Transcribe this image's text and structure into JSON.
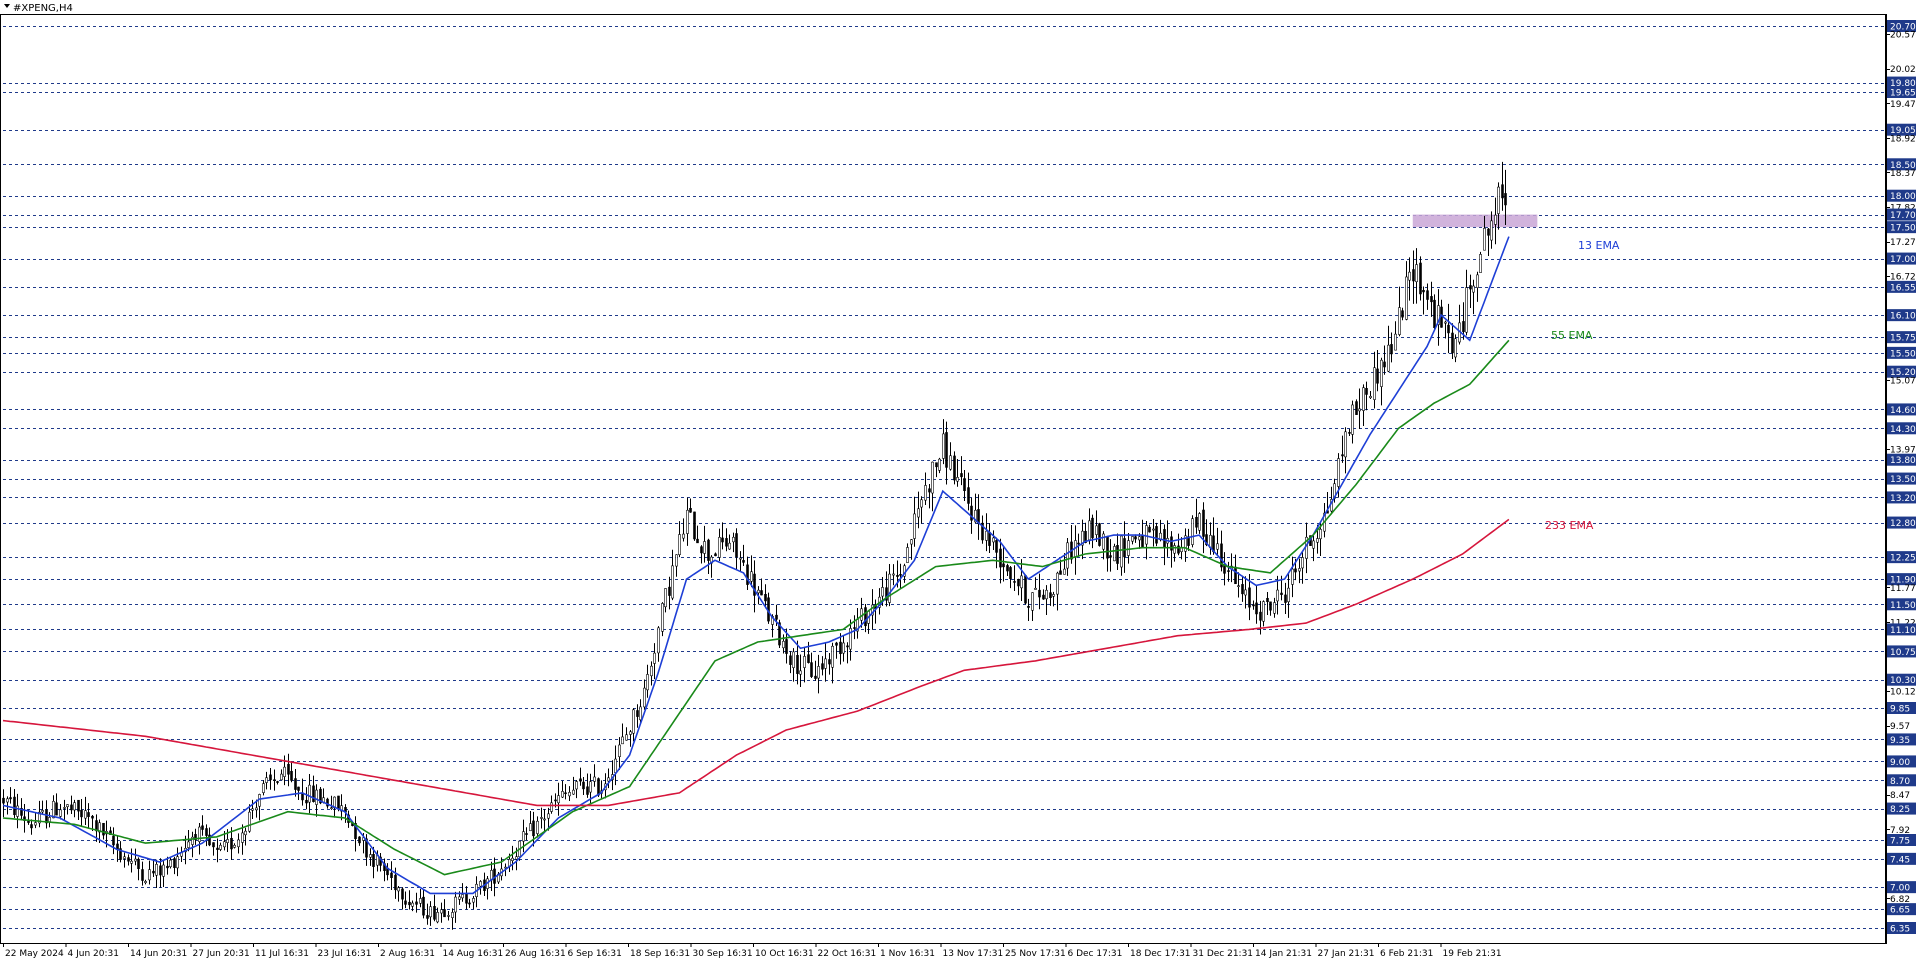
{
  "window": {
    "title": "#XPENG,H4"
  },
  "colors": {
    "background": "#ffffff",
    "candle": "#000000",
    "grid": "#1f3a8a",
    "ema13": "#1e3fd6",
    "ema55": "#1a8a1a",
    "ema233": "#d6163c",
    "zone": "#c9a6d6"
  },
  "chart_data": {
    "type": "line",
    "symbol": "#XPENG",
    "timeframe": "H4",
    "ylim": [
      6.2,
      20.85
    ],
    "price_scale_labels": [
      "20.70",
      "20.57",
      "20.02",
      "19.80",
      "19.65",
      "19.47",
      "19.05",
      "18.92",
      "18.50",
      "18.37",
      "18.00",
      "17.82",
      "17.70",
      "17.50",
      "17.27",
      "17.00",
      "16.72",
      "16.55",
      "16.10",
      "15.75",
      "15.50",
      "15.20",
      "15.07",
      "14.60",
      "14.30",
      "13.97",
      "13.80",
      "13.50",
      "13.20",
      "12.80",
      "12.25",
      "11.90",
      "11.77",
      "11.50",
      "11.22",
      "11.10",
      "10.75",
      "10.30",
      "10.12",
      "9.85",
      "9.57",
      "9.35",
      "9.00",
      "8.70",
      "8.47",
      "8.25",
      "7.92",
      "7.75",
      "7.45",
      "7.00",
      "6.82",
      "6.65",
      "6.35"
    ],
    "horizontal_levels": [
      20.7,
      19.8,
      19.65,
      19.05,
      18.5,
      18.0,
      17.7,
      17.5,
      17.0,
      16.55,
      16.1,
      15.75,
      15.5,
      15.2,
      14.6,
      14.3,
      13.8,
      13.5,
      13.2,
      12.8,
      12.25,
      11.9,
      11.5,
      11.1,
      10.75,
      10.3,
      9.85,
      9.35,
      9.0,
      8.7,
      8.25,
      7.75,
      7.45,
      7.0,
      6.65,
      6.35
    ],
    "highlighted_levels": [
      "20.70",
      "19.80",
      "19.65",
      "19.05",
      "18.50",
      "18.00",
      "17.70",
      "17.50",
      "17.00",
      "16.55",
      "16.10",
      "15.75",
      "15.50",
      "15.20",
      "14.60",
      "14.30",
      "13.80",
      "13.50",
      "13.20",
      "12.80",
      "12.25",
      "11.90",
      "11.50",
      "11.10",
      "10.75",
      "10.30",
      "9.85",
      "9.35",
      "9.00",
      "8.70",
      "8.25",
      "7.75",
      "7.45",
      "7.00",
      "6.65",
      "6.35"
    ],
    "x_labels": [
      "22 May 2024",
      "4 Jun 20:31",
      "14 Jun 20:31",
      "27 Jun 20:31",
      "11 Jul 16:31",
      "23 Jul 16:31",
      "2 Aug 16:31",
      "14 Aug 16:31",
      "26 Aug 16:31",
      "6 Sep 16:31",
      "18 Sep 16:31",
      "30 Sep 16:31",
      "10 Oct 16:31",
      "22 Oct 16:31",
      "1 Nov 16:31",
      "13 Nov 17:31",
      "25 Nov 17:31",
      "6 Dec 17:31",
      "18 Dec 17:31",
      "31 Dec 21:31",
      "14 Jan 21:31",
      "27 Jan 21:31",
      "6 Feb 21:31",
      "19 Feb 21:31"
    ],
    "price_path": [
      [
        0,
        8.4
      ],
      [
        8,
        8.0
      ],
      [
        16,
        8.3
      ],
      [
        24,
        8.1
      ],
      [
        32,
        7.6
      ],
      [
        40,
        7.2
      ],
      [
        46,
        7.3
      ],
      [
        54,
        7.9
      ],
      [
        60,
        7.5
      ],
      [
        66,
        7.8
      ],
      [
        72,
        8.5
      ],
      [
        78,
        8.8
      ],
      [
        84,
        8.5
      ],
      [
        90,
        8.4
      ],
      [
        96,
        8.2
      ],
      [
        102,
        7.6
      ],
      [
        108,
        7.2
      ],
      [
        114,
        6.8
      ],
      [
        120,
        6.6
      ],
      [
        126,
        6.7
      ],
      [
        132,
        6.9
      ],
      [
        138,
        7.2
      ],
      [
        144,
        7.6
      ],
      [
        150,
        8.0
      ],
      [
        156,
        8.4
      ],
      [
        162,
        8.6
      ],
      [
        168,
        8.6
      ],
      [
        174,
        9.3
      ],
      [
        180,
        10.1
      ],
      [
        186,
        11.6
      ],
      [
        192,
        12.9
      ],
      [
        198,
        12.3
      ],
      [
        204,
        12.5
      ],
      [
        210,
        11.9
      ],
      [
        216,
        11.2
      ],
      [
        222,
        10.6
      ],
      [
        228,
        10.4
      ],
      [
        234,
        10.8
      ],
      [
        240,
        11.2
      ],
      [
        246,
        11.6
      ],
      [
        252,
        12.0
      ],
      [
        258,
        13.2
      ],
      [
        264,
        14.0
      ],
      [
        270,
        13.2
      ],
      [
        276,
        12.6
      ],
      [
        282,
        12.1
      ],
      [
        288,
        11.6
      ],
      [
        294,
        11.7
      ],
      [
        300,
        12.4
      ],
      [
        306,
        12.7
      ],
      [
        312,
        12.3
      ],
      [
        318,
        12.6
      ],
      [
        324,
        12.5
      ],
      [
        330,
        12.4
      ],
      [
        336,
        12.8
      ],
      [
        342,
        12.3
      ],
      [
        348,
        11.6
      ],
      [
        354,
        11.4
      ],
      [
        360,
        11.7
      ],
      [
        366,
        12.4
      ],
      [
        372,
        13.0
      ],
      [
        378,
        14.4
      ],
      [
        384,
        15.0
      ],
      [
        390,
        15.6
      ],
      [
        396,
        16.9
      ],
      [
        402,
        16.1
      ],
      [
        408,
        15.6
      ],
      [
        414,
        17.0
      ],
      [
        420,
        17.9
      ],
      [
        423,
        18.0
      ]
    ],
    "series": [
      {
        "name": "13 EMA",
        "values": [
          [
            0,
            8.3
          ],
          [
            16,
            8.1
          ],
          [
            32,
            7.6
          ],
          [
            44,
            7.4
          ],
          [
            56,
            7.7
          ],
          [
            72,
            8.4
          ],
          [
            84,
            8.5
          ],
          [
            96,
            8.2
          ],
          [
            108,
            7.3
          ],
          [
            120,
            6.9
          ],
          [
            132,
            6.9
          ],
          [
            144,
            7.4
          ],
          [
            156,
            8.1
          ],
          [
            168,
            8.5
          ],
          [
            176,
            9.1
          ],
          [
            184,
            10.4
          ],
          [
            192,
            11.9
          ],
          [
            200,
            12.2
          ],
          [
            208,
            12.0
          ],
          [
            216,
            11.3
          ],
          [
            224,
            10.8
          ],
          [
            232,
            10.9
          ],
          [
            240,
            11.1
          ],
          [
            248,
            11.6
          ],
          [
            256,
            12.2
          ],
          [
            264,
            13.3
          ],
          [
            272,
            12.9
          ],
          [
            280,
            12.5
          ],
          [
            288,
            11.9
          ],
          [
            296,
            12.2
          ],
          [
            304,
            12.5
          ],
          [
            312,
            12.6
          ],
          [
            320,
            12.6
          ],
          [
            328,
            12.5
          ],
          [
            336,
            12.6
          ],
          [
            344,
            12.1
          ],
          [
            352,
            11.8
          ],
          [
            360,
            11.9
          ],
          [
            368,
            12.6
          ],
          [
            376,
            13.4
          ],
          [
            384,
            14.2
          ],
          [
            392,
            14.9
          ],
          [
            400,
            15.6
          ],
          [
            404,
            16.1
          ],
          [
            412,
            15.7
          ],
          [
            418,
            16.6
          ],
          [
            423,
            17.35
          ]
        ]
      },
      {
        "name": "55 EMA",
        "values": [
          [
            0,
            8.1
          ],
          [
            20,
            8.0
          ],
          [
            40,
            7.7
          ],
          [
            60,
            7.8
          ],
          [
            80,
            8.2
          ],
          [
            96,
            8.1
          ],
          [
            110,
            7.6
          ],
          [
            124,
            7.2
          ],
          [
            140,
            7.4
          ],
          [
            160,
            8.2
          ],
          [
            176,
            8.6
          ],
          [
            188,
            9.6
          ],
          [
            200,
            10.6
          ],
          [
            212,
            10.9
          ],
          [
            224,
            11.0
          ],
          [
            236,
            11.1
          ],
          [
            248,
            11.6
          ],
          [
            262,
            12.1
          ],
          [
            278,
            12.2
          ],
          [
            292,
            12.1
          ],
          [
            304,
            12.3
          ],
          [
            320,
            12.4
          ],
          [
            332,
            12.4
          ],
          [
            344,
            12.1
          ],
          [
            356,
            12.0
          ],
          [
            368,
            12.6
          ],
          [
            380,
            13.4
          ],
          [
            392,
            14.3
          ],
          [
            402,
            14.7
          ],
          [
            412,
            15.0
          ],
          [
            423,
            15.7
          ]
        ]
      },
      {
        "name": "233 EMA",
        "values": [
          [
            0,
            9.65
          ],
          [
            40,
            9.4
          ],
          [
            80,
            9.0
          ],
          [
            120,
            8.6
          ],
          [
            150,
            8.3
          ],
          [
            170,
            8.3
          ],
          [
            190,
            8.5
          ],
          [
            206,
            9.1
          ],
          [
            220,
            9.5
          ],
          [
            240,
            9.8
          ],
          [
            258,
            10.2
          ],
          [
            270,
            10.45
          ],
          [
            290,
            10.6
          ],
          [
            310,
            10.8
          ],
          [
            330,
            11.0
          ],
          [
            350,
            11.1
          ],
          [
            366,
            11.2
          ],
          [
            380,
            11.5
          ],
          [
            396,
            11.9
          ],
          [
            410,
            12.3
          ],
          [
            423,
            12.85
          ]
        ]
      }
    ],
    "resistance_zone": {
      "low": 17.5,
      "high": 17.7,
      "x_start": 396,
      "x_end": 431
    },
    "bar_count": 423
  },
  "labels": {
    "ema13": "13 EMA",
    "ema55": "55 EMA",
    "ema233": "233 EMA"
  }
}
